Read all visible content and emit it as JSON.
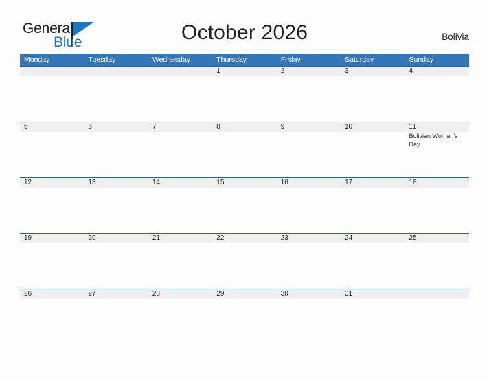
{
  "brand": {
    "name_part1": "General",
    "name_part2": "Blue",
    "triangle_icon": "triangle-icon",
    "accent_color": "#1e76bd"
  },
  "header": {
    "title": "October 2026",
    "country": "Bolivia"
  },
  "calendar": {
    "header_color": "#3576b8",
    "band_color": "#efefef",
    "rule_color": "#2a6099",
    "weekdays": [
      "Monday",
      "Tuesday",
      "Wednesday",
      "Thursday",
      "Friday",
      "Saturday",
      "Sunday"
    ],
    "weeks": [
      [
        {
          "day": ""
        },
        {
          "day": ""
        },
        {
          "day": ""
        },
        {
          "day": "1"
        },
        {
          "day": "2"
        },
        {
          "day": "3"
        },
        {
          "day": "4"
        }
      ],
      [
        {
          "day": "5"
        },
        {
          "day": "6"
        },
        {
          "day": "7"
        },
        {
          "day": "8"
        },
        {
          "day": "9"
        },
        {
          "day": "10"
        },
        {
          "day": "11",
          "events": [
            "Bolivian Woman's Day"
          ]
        }
      ],
      [
        {
          "day": "12"
        },
        {
          "day": "13"
        },
        {
          "day": "14"
        },
        {
          "day": "15"
        },
        {
          "day": "16"
        },
        {
          "day": "17"
        },
        {
          "day": "18"
        }
      ],
      [
        {
          "day": "19"
        },
        {
          "day": "20"
        },
        {
          "day": "21"
        },
        {
          "day": "22"
        },
        {
          "day": "23"
        },
        {
          "day": "24"
        },
        {
          "day": "25"
        }
      ],
      [
        {
          "day": "26"
        },
        {
          "day": "27"
        },
        {
          "day": "28"
        },
        {
          "day": "29"
        },
        {
          "day": "30"
        },
        {
          "day": "31"
        },
        {
          "day": ""
        }
      ]
    ]
  }
}
